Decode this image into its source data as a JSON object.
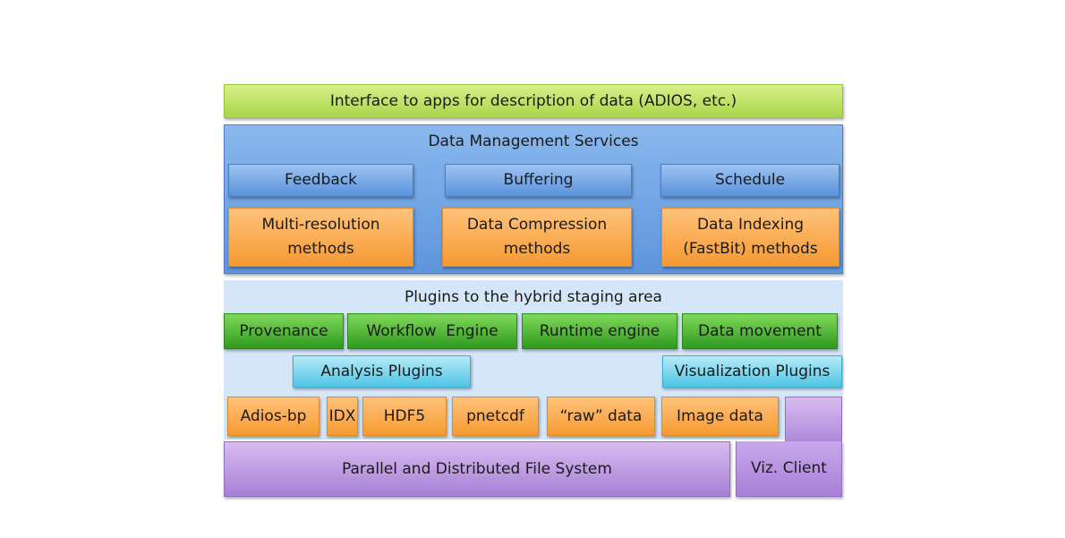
{
  "interface": "Interface to apps for description of data (ADIOS, etc.)",
  "dms": {
    "title": "Data Management Services",
    "services": [
      "Feedback",
      "Buffering",
      "Schedule"
    ],
    "methods": [
      [
        "Multi-resolution",
        "methods"
      ],
      [
        "Data Compression",
        "methods"
      ],
      [
        "Data Indexing",
        "(FastBit) methods"
      ]
    ]
  },
  "plugins": {
    "title": "Plugins to the hybrid staging area",
    "engines": [
      "Provenance",
      "Workflow  Engine",
      "Runtime engine",
      "Data movement"
    ],
    "analysis": "Analysis Plugins",
    "visualization": "Visualization Plugins"
  },
  "formats": [
    "Adios-bp",
    "IDX",
    "HDF5",
    "pnetcdf",
    "“raw” data",
    "Image data"
  ],
  "filesystem": "Parallel and Distributed File System",
  "viz_client": "Viz. Client",
  "colors": {
    "interface": "#b8de5c",
    "dms_panel": "#6a9fe0",
    "method": "#f8a848",
    "plugins_panel": "#d4e6f8",
    "engine": "#4aae2c",
    "plugin": "#7ed4ec",
    "storage": "#b692e0"
  }
}
